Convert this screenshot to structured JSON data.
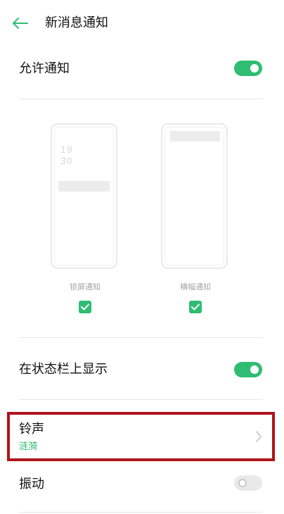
{
  "header": {
    "title": "新消息通知",
    "back_icon": "arrow-left-icon"
  },
  "settings": {
    "allow_notifications": {
      "label": "允许通知",
      "enabled": true
    },
    "notification_styles": [
      {
        "label": "锁屏通知",
        "clock_hour": "19",
        "clock_minute": "30",
        "checked": true
      },
      {
        "label": "横幅通知",
        "checked": true
      }
    ],
    "status_bar": {
      "label": "在状态栏上显示",
      "enabled": true
    },
    "ringtone": {
      "label": "铃声",
      "value": "涟漪"
    },
    "vibration": {
      "label": "振动",
      "enabled": false
    }
  },
  "colors": {
    "accent": "#2ebd72",
    "highlight": "#b0141a",
    "toggle_off": "#e9e9e9"
  }
}
